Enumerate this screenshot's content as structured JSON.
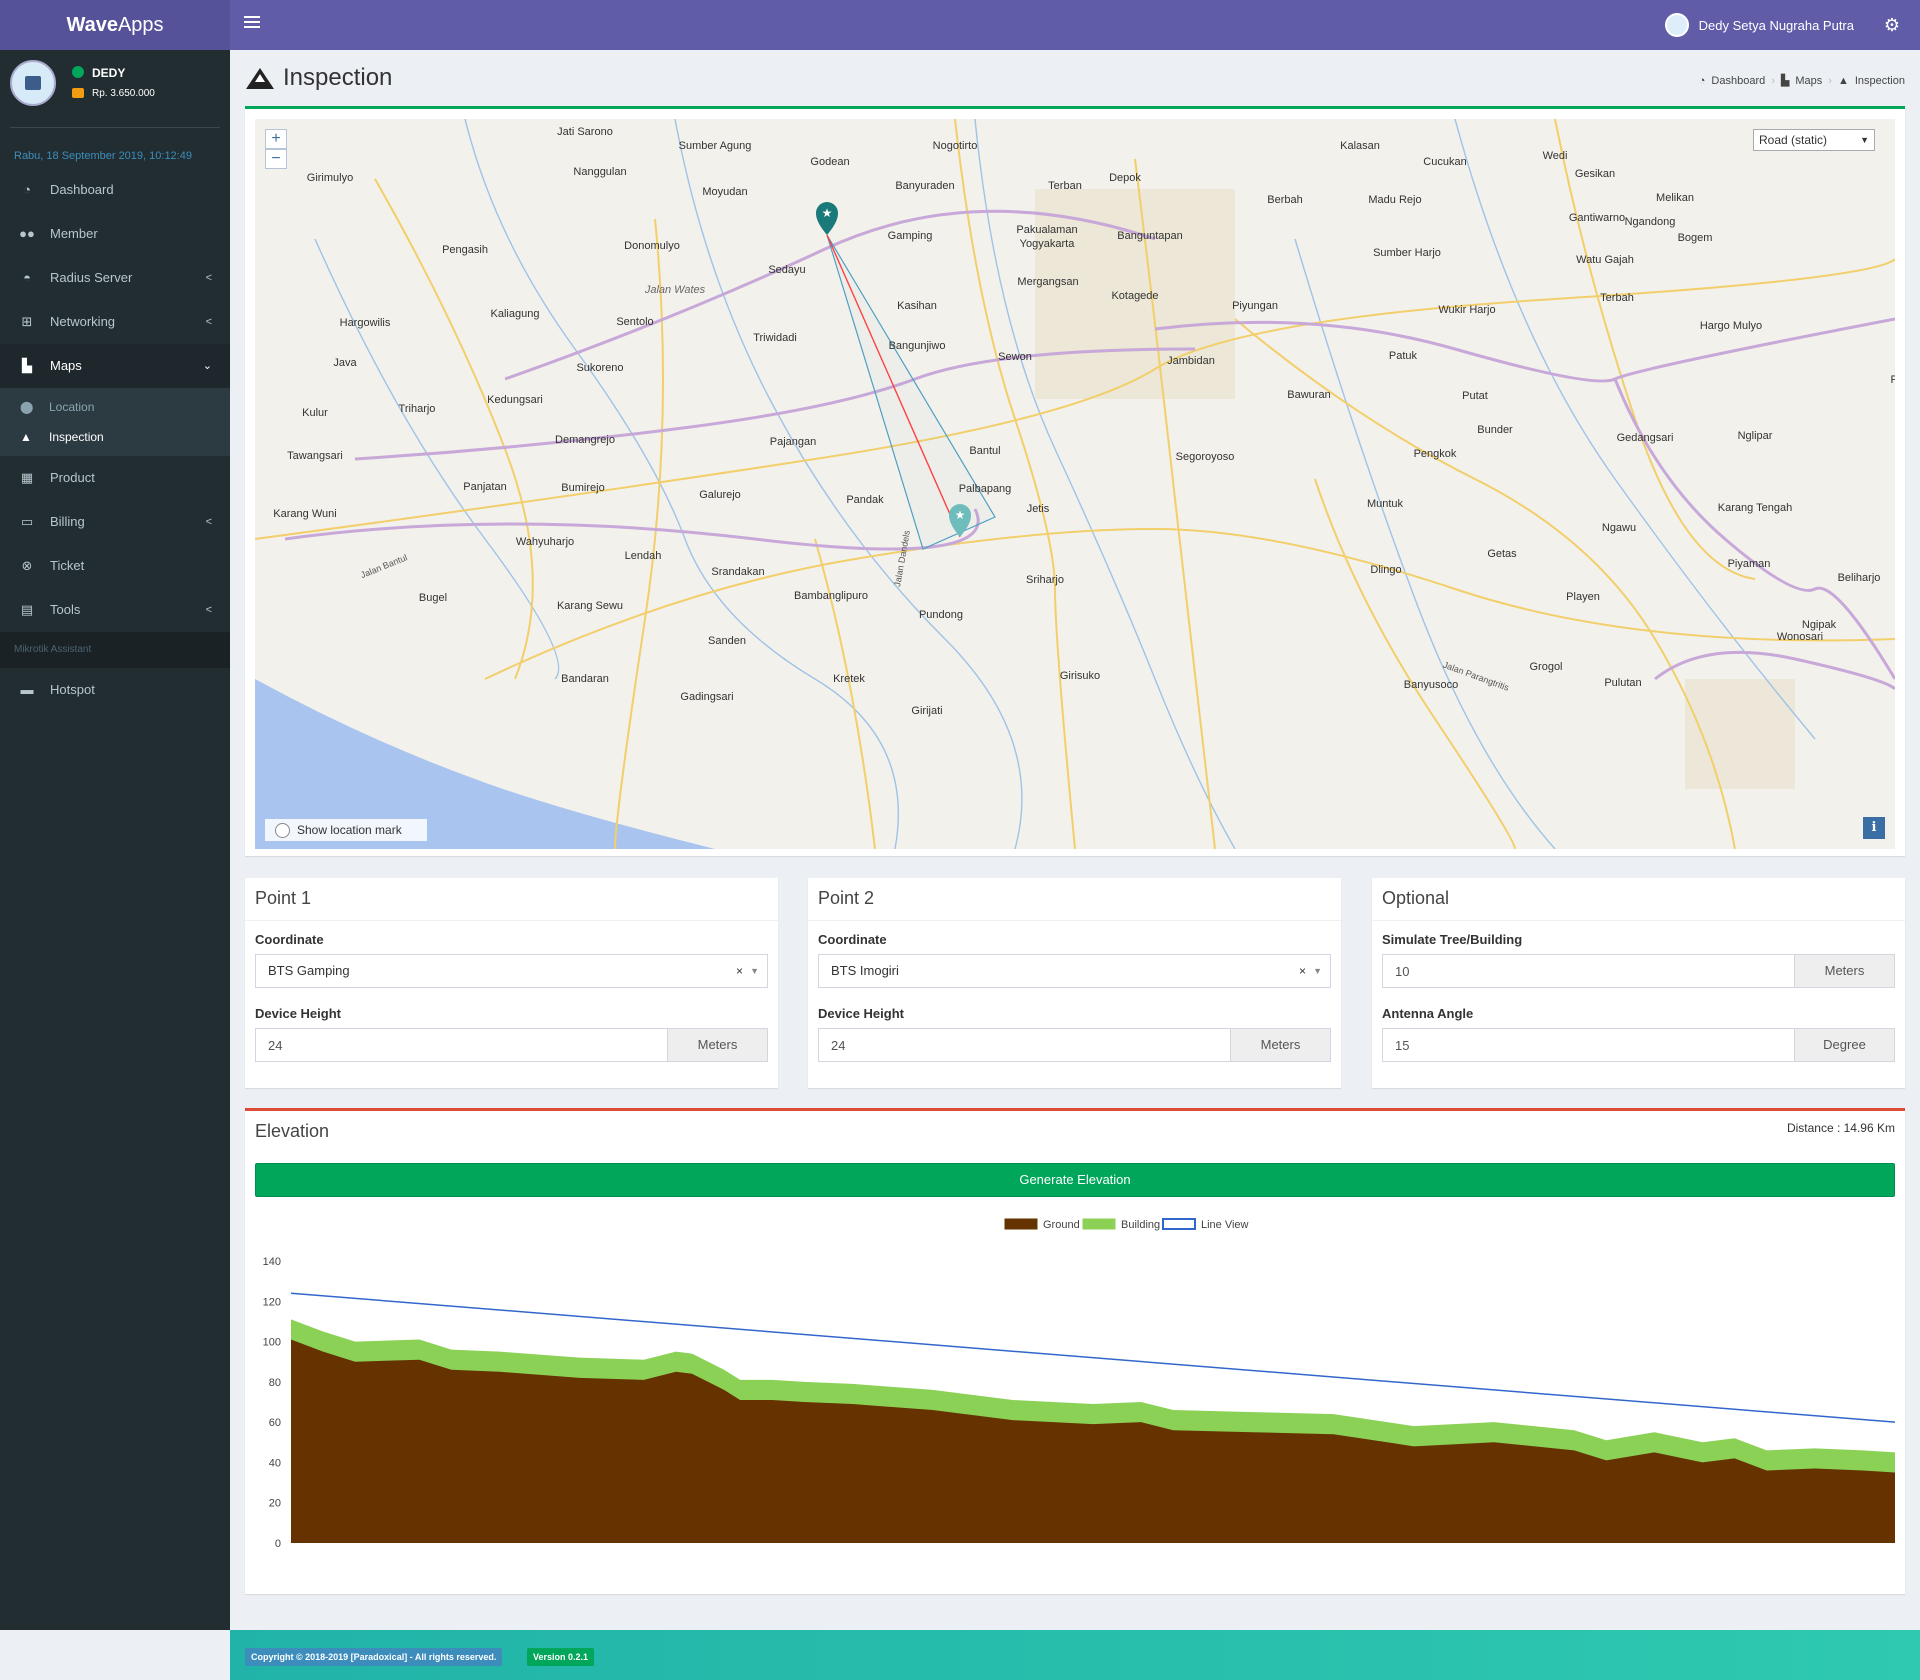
{
  "app": {
    "brand_bold": "Wave",
    "brand_light": "Apps"
  },
  "topbar": {
    "user_name": "Dedy Setya Nugraha Putra"
  },
  "sidebar": {
    "user": {
      "name": "DEDY",
      "balance": "Rp. 3.650.000"
    },
    "datetime": "Rabu, 18 September 2019, 10:12:49",
    "items": [
      {
        "label": "Dashboard"
      },
      {
        "label": "Member"
      },
      {
        "label": "Radius Server"
      },
      {
        "label": "Networking"
      },
      {
        "label": "Maps"
      },
      {
        "label": "Product"
      },
      {
        "label": "Billing"
      },
      {
        "label": "Ticket"
      },
      {
        "label": "Tools"
      },
      {
        "label": "Hotspot"
      }
    ],
    "maps_sub": [
      {
        "label": "Location"
      },
      {
        "label": "Inspection"
      }
    ],
    "section_header": "Mikrotik Assistant"
  },
  "page": {
    "title": "Inspection",
    "breadcrumb": [
      "Dashboard",
      "Maps",
      "Inspection"
    ]
  },
  "map": {
    "zoom_in": "+",
    "zoom_out": "−",
    "map_type": "Road (static)",
    "show_location_mark": "Show location mark",
    "info": "i",
    "places": [
      "Jati Sarono",
      "Sumber Agung",
      "Godean",
      "Nogotirto",
      "Terban",
      "Depok",
      "Kalasan",
      "Cucukan",
      "Wedi",
      "Gesikan",
      "Girimulyo",
      "Nanggulan",
      "Moyudan",
      "Banyuraden",
      "Pakualaman",
      "Yogyakarta",
      "Banguntapan",
      "Berbah",
      "Madu Rejo",
      "Ngandong",
      "Gantiwarno",
      "Melikan",
      "Bogem",
      "Pengasih",
      "Donomulyo",
      "Sedayu",
      "Gamping",
      "Mergangsan",
      "Kotagede",
      "Sumber Harjo",
      "Watu Gajah",
      "Hargowilis",
      "Kaliagung",
      "Sentolo",
      "Triwidadi",
      "Kasihan",
      "Bangunjiwo",
      "Piyungan",
      "Wukir Harjo",
      "Terbah",
      "Hargo Mulyo",
      "Sukoreno",
      "Sewon",
      "Jambidan",
      "Patuk",
      "Pilangrejo",
      "Kulur",
      "Triharjo",
      "Kedungsari",
      "Bawuran",
      "Putat",
      "Demangrejo",
      "Pajangan",
      "Bantul",
      "Segoroyoso",
      "Bunder",
      "Gedangsari",
      "Nglipar",
      "Tawangsari",
      "Pengkok",
      "Panjatan",
      "Bumirejo",
      "Galurejo",
      "Palbapang",
      "Pandak",
      "Jetis",
      "Muntuk",
      "Karang Tengah",
      "Karang Wuni",
      "Wahyuharjo",
      "Lendah",
      "Srandakan",
      "Sriharjo",
      "Dlingo",
      "Getas",
      "Ngawu",
      "Piyaman",
      "Beliharjo",
      "Bugel",
      "Karang Sewu",
      "Bambanglipuro",
      "Pundong",
      "Playen",
      "Ngipak",
      "Sanden",
      "Wonosari",
      "Grogol",
      "Bandaran",
      "Kretek",
      "Girisuko",
      "Banyusoco",
      "Pulutan",
      "Gadingsari",
      "Girijati",
      "Java",
      "Jalan Wates",
      "Jalan Bantul",
      "Jalan Dandels",
      "Jalan Parangtritis"
    ]
  },
  "point1": {
    "title": "Point 1",
    "coordinate_label": "Coordinate",
    "coordinate_value": "BTS Gamping",
    "clear": "×",
    "height_label": "Device Height",
    "height_value": "24",
    "height_unit": "Meters"
  },
  "point2": {
    "title": "Point 2",
    "coordinate_label": "Coordinate",
    "coordinate_value": "BTS Imogiri",
    "clear": "×",
    "height_label": "Device Height",
    "height_value": "24",
    "height_unit": "Meters"
  },
  "optional": {
    "title": "Optional",
    "tree_label": "Simulate Tree/Building",
    "tree_value": "10",
    "tree_unit": "Meters",
    "angle_label": "Antenna Angle",
    "angle_value": "15",
    "angle_unit": "Degree"
  },
  "elevation": {
    "title": "Elevation",
    "distance": "Distance : 14.96 Km",
    "button": "Generate Elevation"
  },
  "chart_data": {
    "type": "area",
    "title": "",
    "xlabel": "",
    "ylabel": "",
    "ylim": [
      0,
      140
    ],
    "yticks": [
      0,
      20,
      40,
      60,
      80,
      100,
      120,
      140
    ],
    "legend": [
      "Ground",
      "Building",
      "Line View"
    ],
    "legend_position": "top-center",
    "colors": {
      "ground": "#663300",
      "building": "#8bd156",
      "line_view": "#3366cc"
    },
    "x_fraction": [
      0,
      0.02,
      0.04,
      0.08,
      0.1,
      0.13,
      0.18,
      0.22,
      0.24,
      0.25,
      0.27,
      0.28,
      0.3,
      0.32,
      0.35,
      0.4,
      0.45,
      0.5,
      0.53,
      0.55,
      0.6,
      0.65,
      0.7,
      0.75,
      0.8,
      0.82,
      0.85,
      0.88,
      0.9,
      0.92,
      0.95,
      0.98,
      1.0
    ],
    "series": [
      {
        "name": "Ground",
        "values": [
          101,
          95,
          90,
          91,
          86,
          85,
          82,
          81,
          85,
          84,
          76,
          71,
          71,
          70,
          69,
          66,
          61,
          59,
          60,
          56,
          55,
          54,
          48,
          50,
          46,
          41,
          45,
          40,
          42,
          36,
          37,
          36,
          35
        ]
      },
      {
        "name": "Building",
        "values": [
          10,
          10,
          10,
          10,
          10,
          10,
          10,
          10,
          10,
          10,
          10,
          10,
          10,
          10,
          10,
          10,
          10,
          10,
          10,
          10,
          10,
          10,
          10,
          10,
          10,
          10,
          10,
          10,
          10,
          10,
          10,
          10,
          10
        ]
      },
      {
        "name": "Line View",
        "start": 124,
        "end": 60
      }
    ]
  },
  "footer": {
    "copyright": "Copyright © 2018-2019 [Paradoxical] - All rights reserved.",
    "version": "Version 0.2.1"
  }
}
